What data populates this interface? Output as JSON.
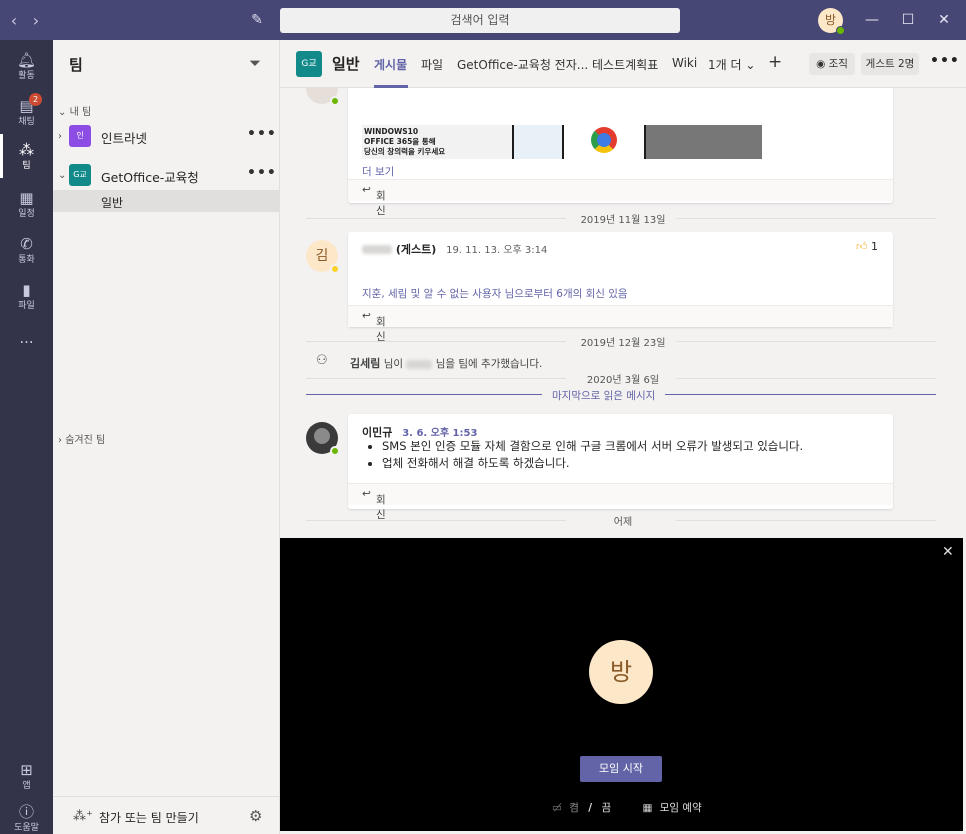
{
  "topbar": {
    "search_placeholder": "검색어 입력",
    "user_initial": "방"
  },
  "rail": {
    "items": [
      {
        "label": "활동"
      },
      {
        "label": "채팅",
        "badge": "2"
      },
      {
        "label": "팀"
      },
      {
        "label": "일정"
      },
      {
        "label": "통화"
      },
      {
        "label": "파일"
      },
      {
        "label": "..."
      },
      {
        "label": "앱"
      },
      {
        "label": "도움말"
      }
    ]
  },
  "panel": {
    "title": "팀",
    "my_teams_label": "내 팀",
    "teams": [
      {
        "tile": "인",
        "name": "인트라넷",
        "color": "#8b4de3"
      },
      {
        "tile": "G교",
        "name": "GetOffice-교육청",
        "color": "#138a8a"
      }
    ],
    "channel": "일반",
    "hidden_teams_label": "숨겨진 팀",
    "join_label": "참가 또는 팀 만들기"
  },
  "header": {
    "tile": "G교",
    "channel_name": "일반",
    "tabs": [
      "게시물",
      "파일",
      "GetOffice-교육청 전자...",
      "테스트계획표",
      "Wiki",
      "1개 더"
    ],
    "org_button": "조직",
    "guest_button": "게스트 2명"
  },
  "feed": {
    "more_label": "더 보기",
    "reply_label": "회신",
    "date1": "2019년 11월 13일",
    "post1": {
      "avatar": "김",
      "guest_tag": "(게스트)",
      "time": "19. 11. 13. 오후 3:14",
      "likes": "1",
      "replies_text": "지훈, 세림 및 알 수 없는 사용자 님으로부터 6개의 회신 있음"
    },
    "date2": "2019년 12월 23일",
    "system_msg": {
      "actor": "김세림",
      "prefix": " 님이 ",
      "suffix": " 님을 팀에 추가했습니다."
    },
    "date3": "2020년 3월 6일",
    "last_read": "마지막으로 읽은 메시지",
    "post2": {
      "author": "이민규",
      "time": "3. 6. 오후 1:53",
      "bullets": [
        "SMS 본인 인증 모듈 자체 결함으로 인해 구글 크롬에서 서버 오류가 발생되고 있습니다.",
        "업체 전화해서 해결 하도록 하겠습니다."
      ]
    },
    "date4": "어제",
    "preview_text": [
      "WINDOWS10",
      "OFFICE 365을 통해",
      "당신의 창의력을 키우세요"
    ]
  },
  "meeting": {
    "avatar": "방",
    "start_label": "모임 시작",
    "cam_label": "켬",
    "sep": "/",
    "off_label": "끔",
    "schedule_label": "모임 예약"
  },
  "colors": {
    "accent": "#6264a7",
    "topbar": "#464775",
    "rail": "#33344a"
  }
}
